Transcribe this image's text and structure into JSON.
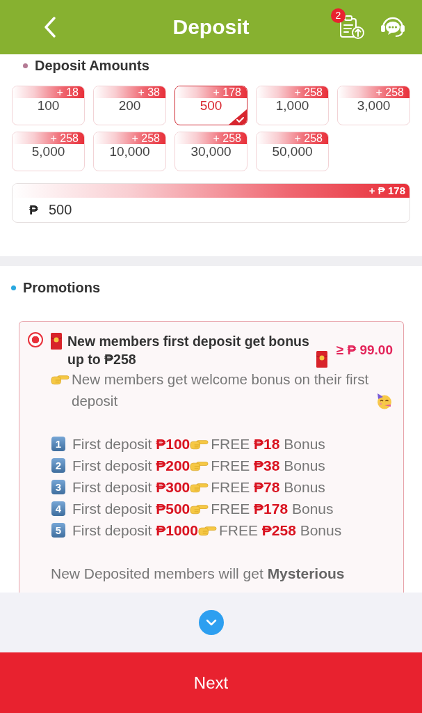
{
  "header": {
    "title": "Deposit",
    "notification_count": "2"
  },
  "deposit": {
    "title": "Deposit Amounts",
    "options": [
      {
        "amount": "100",
        "bonus": "+ 18",
        "selected": false
      },
      {
        "amount": "200",
        "bonus": "+ 38",
        "selected": false
      },
      {
        "amount": "500",
        "bonus": "+ 178",
        "selected": true
      },
      {
        "amount": "1,000",
        "bonus": "+ 258",
        "selected": false
      },
      {
        "amount": "3,000",
        "bonus": "+ 258",
        "selected": false
      },
      {
        "amount": "5,000",
        "bonus": "+ 258",
        "selected": false
      },
      {
        "amount": "10,000",
        "bonus": "+ 258",
        "selected": false
      },
      {
        "amount": "30,000",
        "bonus": "+ 258",
        "selected": false
      },
      {
        "amount": "50,000",
        "bonus": "+ 258",
        "selected": false
      }
    ],
    "amount_field": {
      "bonus": "+ ₱ 178",
      "currency": "₱",
      "value": "500"
    }
  },
  "promotions": {
    "title": "Promotions",
    "items": [
      {
        "selected": true,
        "title": "New members first deposit get bonus up to ₱258",
        "minimum": "≥ ₱ 99.00",
        "intro": "New members get welcome bonus on their first deposit",
        "steps": [
          {
            "number": "1",
            "deposit": "First deposit **₱100**",
            "reward": "FREE **₱18** Bonus"
          },
          {
            "number": "2",
            "deposit": "First deposit **₱200**",
            "reward": "FREE **₱38** Bonus"
          },
          {
            "number": "3",
            "deposit": "First deposit **₱300**",
            "reward": "FREE **₱78** Bonus"
          },
          {
            "number": "4",
            "deposit": "First deposit **₱500**",
            "reward": "FREE **₱178** Bonus"
          },
          {
            "number": "5",
            "deposit": "First deposit **₱1000**",
            "reward": "FREE **₱258** Bonus"
          }
        ],
        "note": "New Deposited members will get **Mysterious**"
      }
    ]
  },
  "next_button": {
    "label": "Next"
  }
}
